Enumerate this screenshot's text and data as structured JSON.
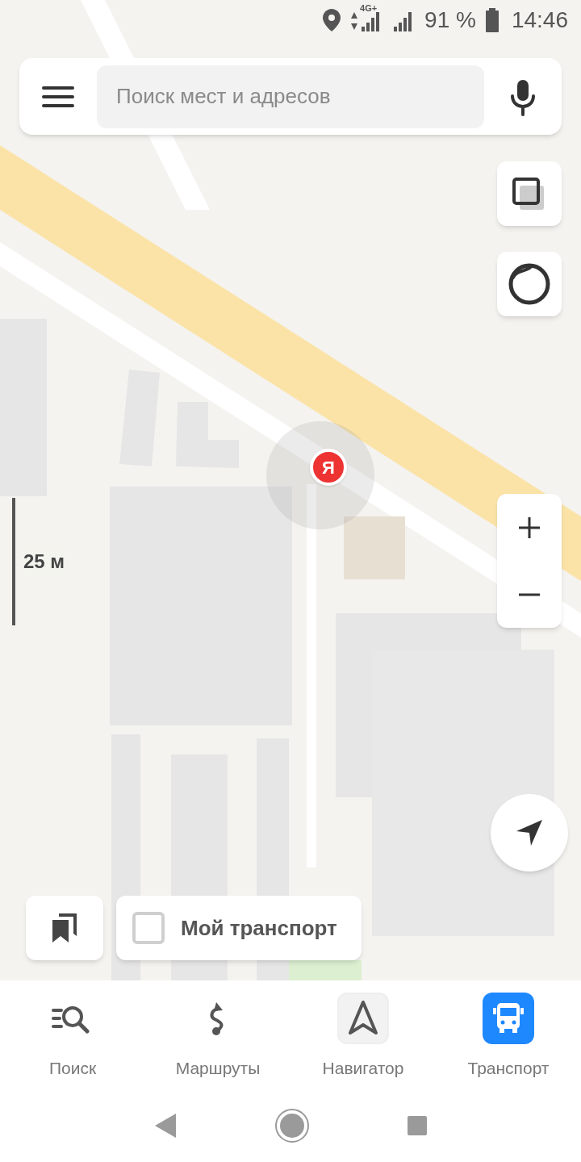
{
  "status_bar": {
    "network": "4G+",
    "battery": "91 %",
    "time": "14:46"
  },
  "search": {
    "placeholder": "Поиск мест и адресов"
  },
  "scale": {
    "label": "25 м"
  },
  "location_marker": {
    "label": "Я"
  },
  "my_transport": {
    "label": "Мой транспорт",
    "checked": false
  },
  "tabs": [
    {
      "label": "Поиск",
      "kind": "search",
      "selected": false,
      "boxed": false
    },
    {
      "label": "Маршруты",
      "kind": "routes",
      "selected": false,
      "boxed": false
    },
    {
      "label": "Навигатор",
      "kind": "navigator",
      "selected": false,
      "boxed": true
    },
    {
      "label": "Транспорт",
      "kind": "transport",
      "selected": true,
      "boxed": false
    }
  ]
}
